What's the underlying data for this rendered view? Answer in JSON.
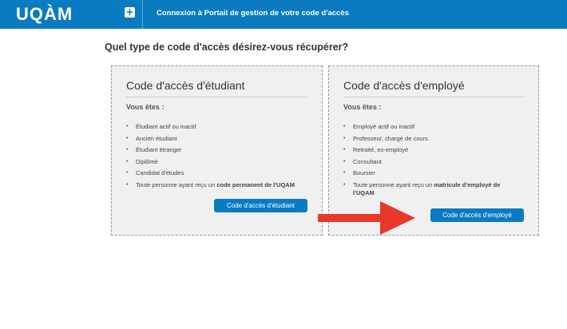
{
  "header": {
    "logo": "UQÀM",
    "plus_icon": "+",
    "title": "Connexion à Portail de gestion de votre code d'accès"
  },
  "main": {
    "question": "Quel type de code d'accès désirez-vous récupérer?"
  },
  "student_card": {
    "title": "Code d'accès d'étudiant",
    "subtitle": "Vous êtes :",
    "items": [
      "Étudiant actif ou inactif",
      "Ancien étudiant",
      "Étudiant étranger",
      "Diplômé",
      "Candidat d'études"
    ],
    "last_item_prefix": "Toute personne ayant reçu un ",
    "last_item_bold": "code permanent de l'UQAM",
    "button_label": "Code d'accès d'étudiant"
  },
  "employee_card": {
    "title": "Code d'accès d'employé",
    "subtitle": "Vous êtes :",
    "items": [
      "Employé actif ou inactif",
      "Professeur, chargé de cours",
      "Retraité, ex-employé",
      "Consultant",
      "Boursier"
    ],
    "last_item_prefix": "Toute personne ayant reçu un ",
    "last_item_bold": "matricule d'employé de l'UQAM",
    "button_label": "Code d'accès d'employé"
  },
  "colors": {
    "brand_blue": "#0a7bc1",
    "arrow_red": "#e8382c",
    "card_bg": "#f0f0f0"
  },
  "icons": {
    "menu": "plus-icon",
    "annotation": "red-arrow-icon"
  }
}
